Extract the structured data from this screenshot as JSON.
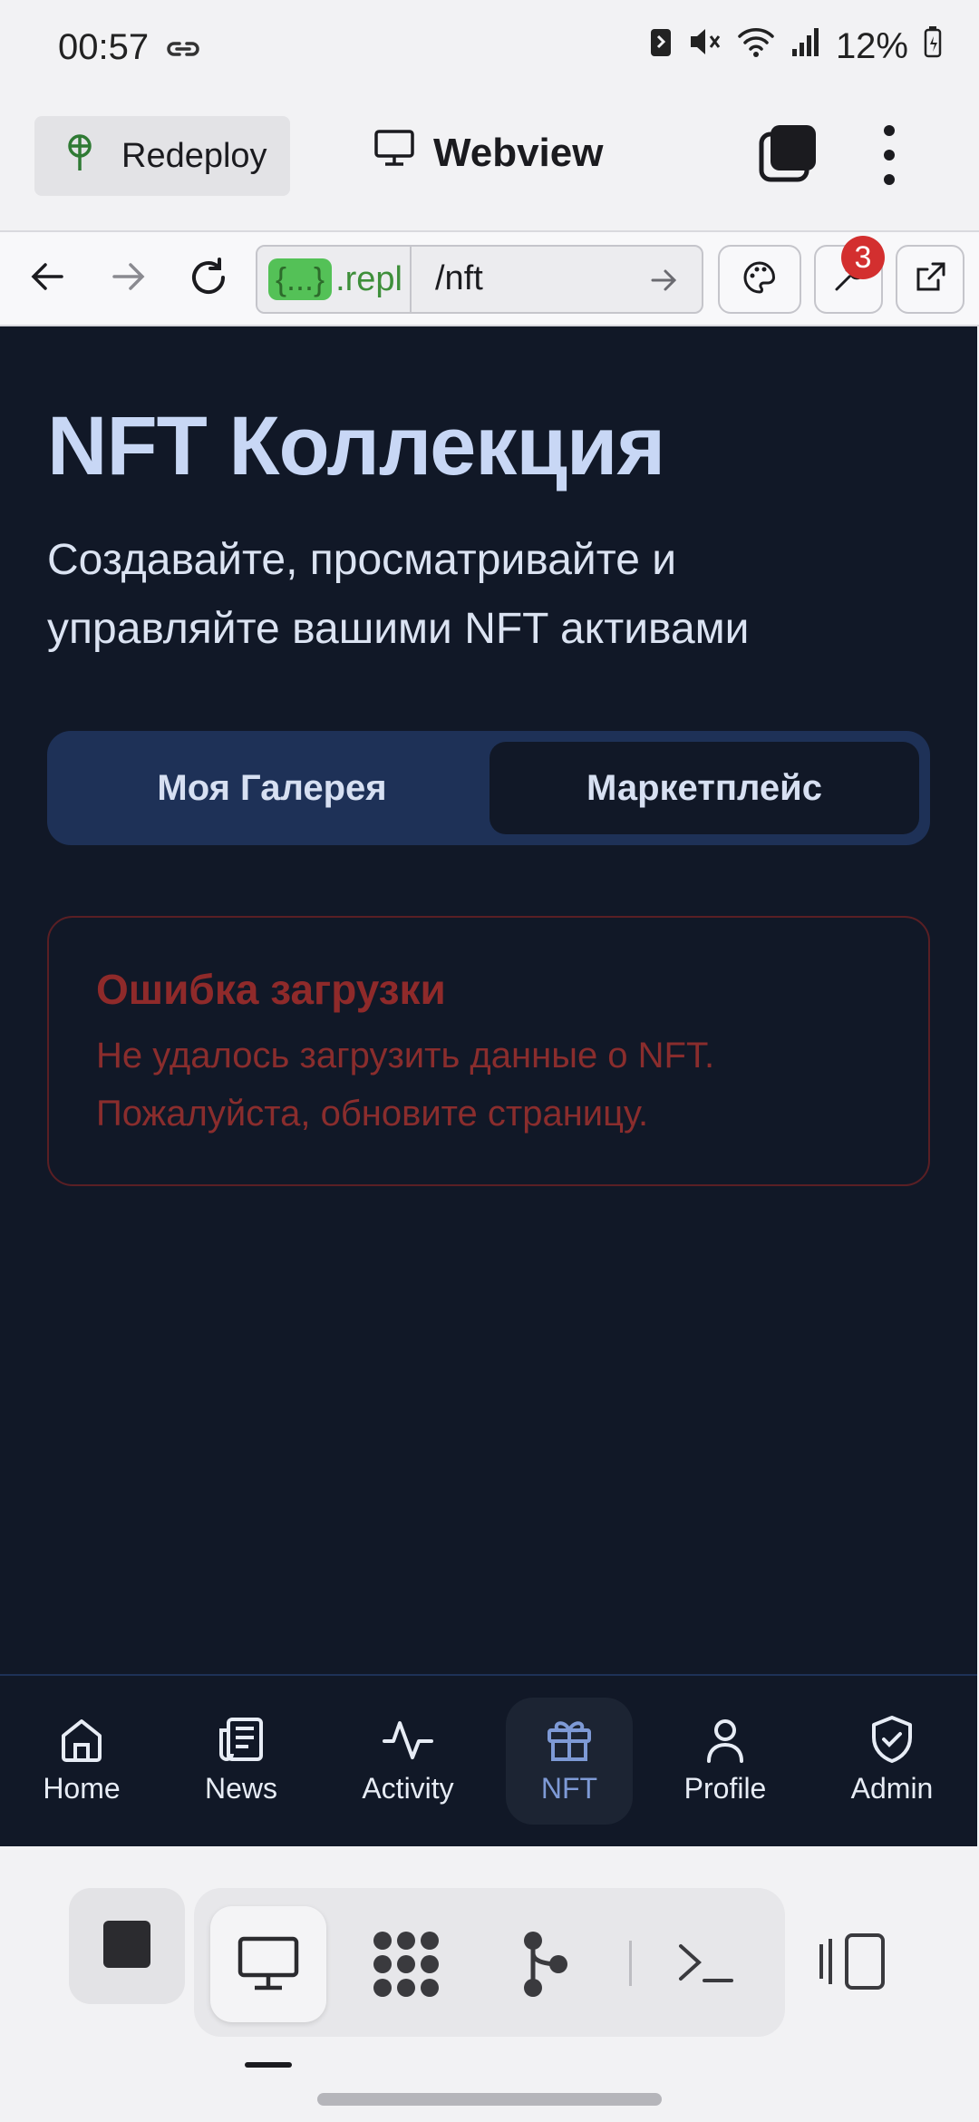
{
  "status_bar": {
    "time": "00:57",
    "battery": "12%"
  },
  "app_bar": {
    "redeploy_label": "Redeploy",
    "title": "Webview"
  },
  "browser": {
    "host": ".repl",
    "host_chip": "{...}",
    "path": "/nft",
    "badge_count": "3"
  },
  "page": {
    "title": "NFT Коллекция",
    "subtitle": "Создавайте, просматривайте и управляйте вашими NFT активами",
    "tabs": [
      {
        "label": "Моя Галерея"
      },
      {
        "label": "Маркетплейс"
      }
    ],
    "error": {
      "title": "Ошибка загрузки",
      "message": "Не удалось загрузить данные о NFT. Пожалуйста, обновите страницу."
    }
  },
  "bottom_nav": {
    "items": [
      {
        "label": "Home",
        "icon": "home-icon"
      },
      {
        "label": "News",
        "icon": "newspaper-icon"
      },
      {
        "label": "Activity",
        "icon": "activity-icon"
      },
      {
        "label": "NFT",
        "icon": "gift-icon",
        "active": true
      },
      {
        "label": "Profile",
        "icon": "user-icon"
      },
      {
        "label": "Admin",
        "icon": "shield-check-icon"
      }
    ]
  },
  "colors": {
    "page_bg": "#111827",
    "title": "#c8d7f5",
    "tab_container": "#1e3157",
    "error_text": "#8f2a2a",
    "nav_active": "#7e9ad6"
  }
}
